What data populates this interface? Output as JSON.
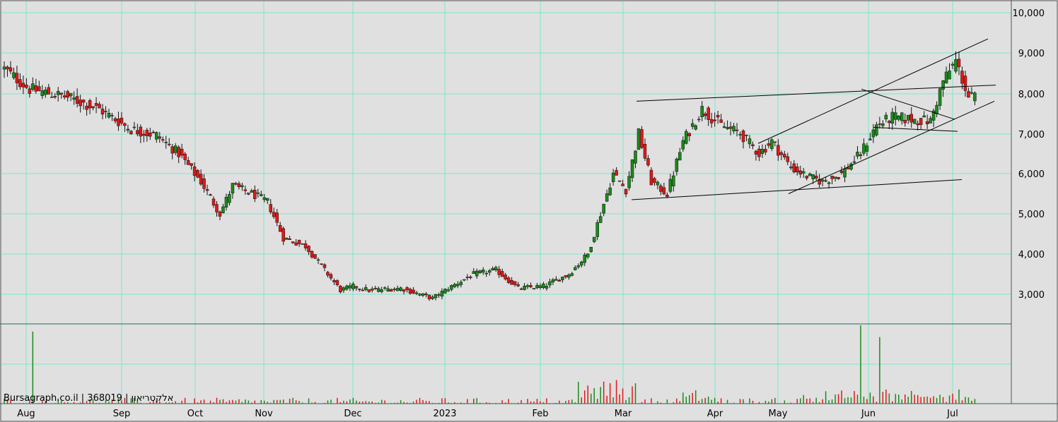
{
  "chart_data": {
    "type": "candlestick",
    "watermark": "Bursagraph.co.il | 368019 | אלקטריאון",
    "y_ticks": [
      "10,000",
      "9,000",
      "8,000",
      "7,000",
      "6,000",
      "5,000",
      "4,000",
      "3,000"
    ],
    "y_tick_values": [
      10000,
      9000,
      8000,
      7000,
      6000,
      5000,
      4000,
      3000
    ],
    "x_ticks": [
      "Aug",
      "Sep",
      "Oct",
      "Nov",
      "Dec",
      "2023",
      "Feb",
      "Mar",
      "Apr",
      "May",
      "Jun",
      "Jul"
    ],
    "ylim": [
      2250,
      10300
    ],
    "grid": true,
    "colors": {
      "up": "#1a8a1a",
      "down": "#e01818",
      "grid": "#7de8c8",
      "background": "#e0e0e0"
    },
    "price_anchors": [
      [
        0,
        8600
      ],
      [
        8,
        8100
      ],
      [
        20,
        7900
      ],
      [
        30,
        7600
      ],
      [
        40,
        7100
      ],
      [
        48,
        6950
      ],
      [
        55,
        6500
      ],
      [
        62,
        5800
      ],
      [
        68,
        5000
      ],
      [
        72,
        5700
      ],
      [
        78,
        5500
      ],
      [
        83,
        5300
      ],
      [
        88,
        4400
      ],
      [
        95,
        4200
      ],
      [
        100,
        3700
      ],
      [
        106,
        3100
      ],
      [
        110,
        3200
      ],
      [
        115,
        3100
      ],
      [
        125,
        3150
      ],
      [
        135,
        2900
      ],
      [
        140,
        3150
      ],
      [
        148,
        3500
      ],
      [
        155,
        3600
      ],
      [
        162,
        3150
      ],
      [
        170,
        3200
      ],
      [
        178,
        3500
      ],
      [
        184,
        4000
      ],
      [
        188,
        5000
      ],
      [
        192,
        6000
      ],
      [
        196,
        5600
      ],
      [
        200,
        7000
      ],
      [
        204,
        5800
      ],
      [
        209,
        5500
      ],
      [
        214,
        6800
      ],
      [
        220,
        7600
      ],
      [
        226,
        7200
      ],
      [
        232,
        7000
      ],
      [
        238,
        6500
      ],
      [
        242,
        6800
      ],
      [
        248,
        6150
      ],
      [
        254,
        5900
      ],
      [
        258,
        5800
      ],
      [
        264,
        6000
      ],
      [
        270,
        6500
      ],
      [
        275,
        7200
      ],
      [
        280,
        7400
      ],
      [
        286,
        7350
      ],
      [
        292,
        7300
      ],
      [
        296,
        8300
      ],
      [
        300,
        8800
      ],
      [
        304,
        7900
      ]
    ],
    "volume_spikes": [
      [
        9,
        0.92
      ],
      [
        270,
        1.0
      ],
      [
        276,
        0.85
      ],
      [
        278,
        0.18
      ]
    ],
    "trend_lines": [
      [
        [
          900,
          7800
        ],
        [
          1408,
          8200
        ]
      ],
      [
        [
          893,
          5350
        ],
        [
          1360,
          5850
        ]
      ],
      [
        [
          1115,
          5500
        ],
        [
          1406,
          7800
        ]
      ],
      [
        [
          1072,
          6750
        ],
        [
          1397,
          9350
        ]
      ],
      [
        [
          1218,
          8100
        ],
        [
          1350,
          7350
        ]
      ],
      [
        [
          1235,
          7150
        ],
        [
          1354,
          7050
        ]
      ]
    ]
  }
}
